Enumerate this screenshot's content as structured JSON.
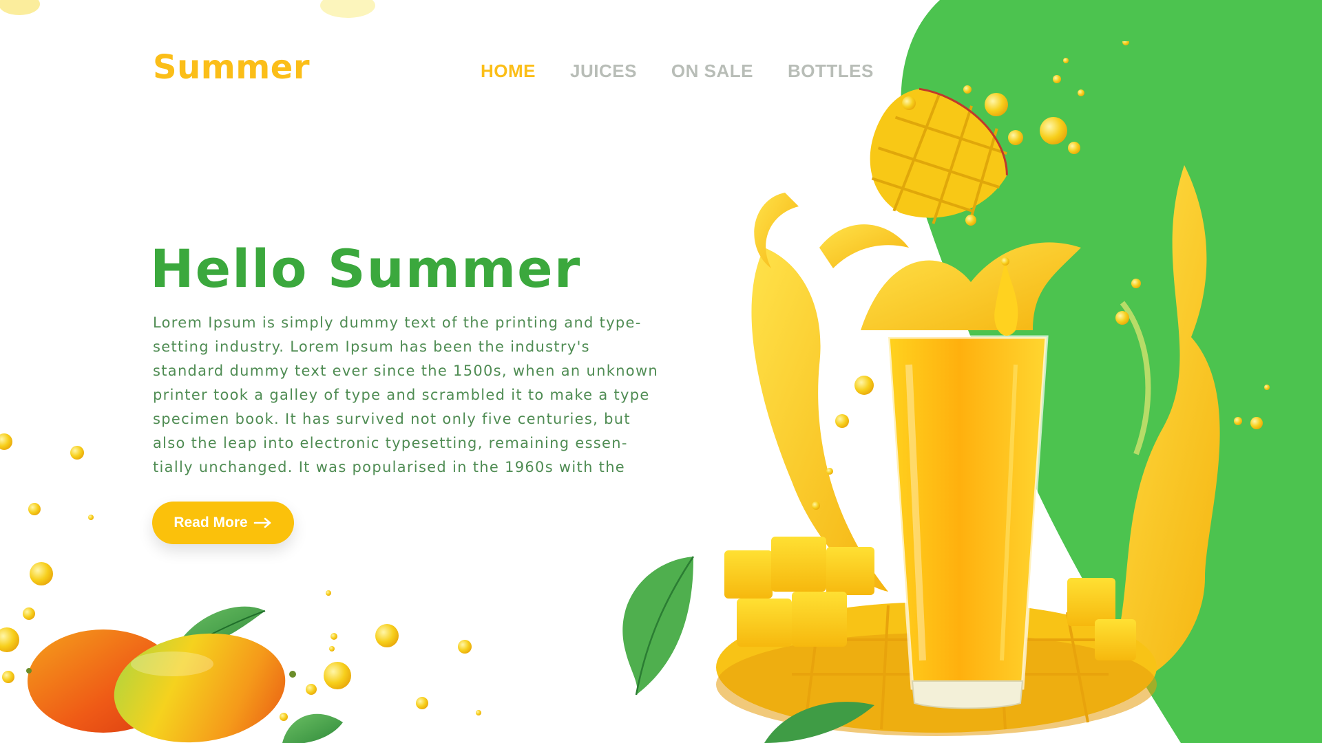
{
  "brand": {
    "logo_text": "Summer"
  },
  "nav": {
    "items": [
      {
        "label": "HOME",
        "active": true
      },
      {
        "label": "JUICES",
        "active": false
      },
      {
        "label": "ON SALE",
        "active": false
      },
      {
        "label": "BOTTLES",
        "active": false
      }
    ]
  },
  "hero": {
    "title": "Hello Summer",
    "body": "Lorem Ipsum is simply dummy text of the printing and type-\nsetting industry. Lorem Ipsum has been the industry's\nstandard dummy text ever since the 1500s, when an unknown\nprinter took a galley of type and scrambled it to make a type\nspecimen book. It has survived not only five centuries, but\nalso the leap into electronic typesetting, remaining essen-\ntially unchanged. It was popularised in the 1960s with the",
    "button_label": "Read More"
  },
  "colors": {
    "accent_yellow": "#fbbe18",
    "brand_green": "#3ba83d",
    "panel_green": "#4cc34f",
    "nav_inactive": "#b8bdb7"
  },
  "icons": {
    "button_icon": "arrow-right-icon"
  }
}
